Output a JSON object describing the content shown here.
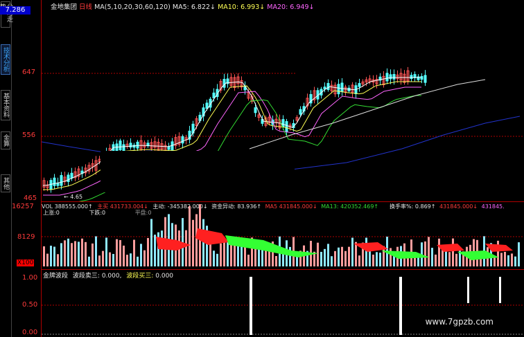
{
  "sidebar": {
    "tabs": [
      {
        "label": "分时走势",
        "active": false
      },
      {
        "label": "技术分析",
        "active": true
      },
      {
        "label": "基本资料",
        "active": false
      },
      {
        "label": "金算",
        "active": false
      },
      {
        "label": "其他",
        "active": false
      }
    ],
    "current_price": "7.286"
  },
  "main_chart": {
    "stock_name": "金地集团",
    "period": "日线",
    "ma_params": "MA(5,10,20,30,60,120)",
    "ma5_label": "MA5:",
    "ma5_value": "6.822↓",
    "ma10_label": "MA10:",
    "ma10_value": "6.993↓",
    "ma20_label": "MA20:",
    "ma20_value": "6.949↓",
    "y_ticks": [
      "647",
      "556",
      "465"
    ],
    "low_label": "← 4.65"
  },
  "volume_panel": {
    "vol_label": "VOL 388555.000↑",
    "zhuli_label": "主买",
    "zhuli_value": "431733.004↓",
    "zhudong_label": "主动:",
    "zhudong_value": "-345382.000↓",
    "fund_label": "资金异动:",
    "fund_value": "83.936↑",
    "ma5_label": "MA5",
    "ma5_value": "431845.000↓",
    "ma13_label": "MA13:",
    "ma13_value": "420352.469↑",
    "turnover_label": "换手率%:",
    "turnover_value": "0.869↑",
    "extra1": "431845.000↓",
    "extra2": "431845.",
    "up_label": "上涨:0",
    "down_label": "下跌:0",
    "flat_label": "平盘:0",
    "y_ticks": [
      "16257",
      "8129",
      "X100"
    ]
  },
  "indicator_panel": {
    "name": "金牌波段",
    "sell_label": "波段卖三:",
    "sell_value": "0.000,",
    "buy_label": "波段买三:",
    "buy_value": "0.000",
    "y_ticks": [
      "1.00",
      "0.50",
      "0.00"
    ]
  },
  "watermark": "www.7gpzb.com",
  "colors": {
    "background": "#000000",
    "grid_red": "#b00000",
    "candle_up": "#ff5555",
    "candle_down": "#55ffff",
    "ma5": "#ffffff",
    "ma10": "#ffff55",
    "ma20": "#ff66ff",
    "ma30": "#33dd33",
    "ma60": "#dddddd",
    "ma120": "#2233cc",
    "watermark": "#e8e8e8"
  }
}
